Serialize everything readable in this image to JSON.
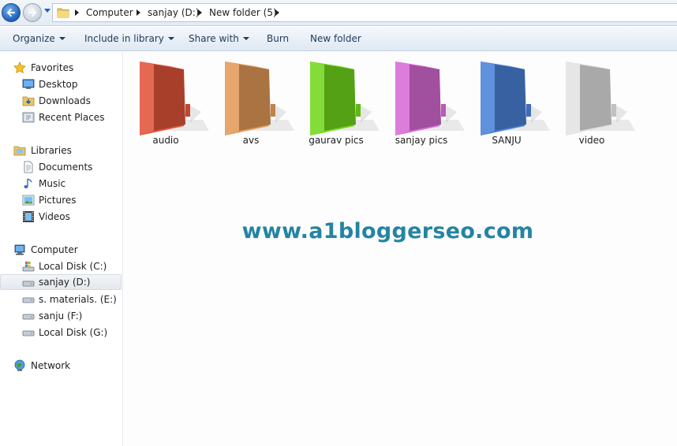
{
  "address_bar": {
    "breadcrumbs": [
      "Computer",
      "sanjay (D:)",
      "New folder (5)"
    ],
    "icons": {
      "back": "back-arrow-icon",
      "forward": "forward-arrow-icon",
      "history": "chevron-down-icon",
      "folder": "folder-icon"
    }
  },
  "toolbar": {
    "organize_label": "Organize",
    "include_label": "Include in library",
    "share_label": "Share with",
    "burn_label": "Burn",
    "new_folder_label": "New folder"
  },
  "nav": {
    "favorites": {
      "label": "Favorites",
      "icon": "star-icon",
      "items": [
        {
          "label": "Desktop",
          "icon": "desktop-icon"
        },
        {
          "label": "Downloads",
          "icon": "downloads-folder-icon"
        },
        {
          "label": "Recent Places",
          "icon": "recent-places-icon"
        }
      ]
    },
    "libraries": {
      "label": "Libraries",
      "icon": "libraries-icon",
      "items": [
        {
          "label": "Documents",
          "icon": "documents-icon"
        },
        {
          "label": "Music",
          "icon": "music-note-icon"
        },
        {
          "label": "Pictures",
          "icon": "pictures-icon"
        },
        {
          "label": "Videos",
          "icon": "film-strip-icon"
        }
      ]
    },
    "computer": {
      "label": "Computer",
      "icon": "computer-icon",
      "items": [
        {
          "label": "Local Disk (C:)",
          "icon": "windows-drive-icon"
        },
        {
          "label": "sanjay (D:)",
          "icon": "drive-icon",
          "selected": true
        },
        {
          "label": "s. materials. (E:)",
          "icon": "drive-icon"
        },
        {
          "label": "sanju (F:)",
          "icon": "drive-icon"
        },
        {
          "label": "Local Disk (G:)",
          "icon": "drive-icon"
        }
      ]
    },
    "network": {
      "label": "Network",
      "icon": "network-icon"
    }
  },
  "folders": [
    {
      "label": "audio",
      "color": "#e2553b"
    },
    {
      "label": "avs",
      "color": "#e39a5a"
    },
    {
      "label": "gaurav pics",
      "color": "#72d81c"
    },
    {
      "label": "sanjay pics",
      "color": "#d86bd6"
    },
    {
      "label": "SANJU",
      "color": "#4a82d8"
    },
    {
      "label": "video",
      "color": "#e3e3e3"
    }
  ],
  "watermark": {
    "text": "www.a1bloggerseo.com",
    "color": "#2484a2"
  }
}
